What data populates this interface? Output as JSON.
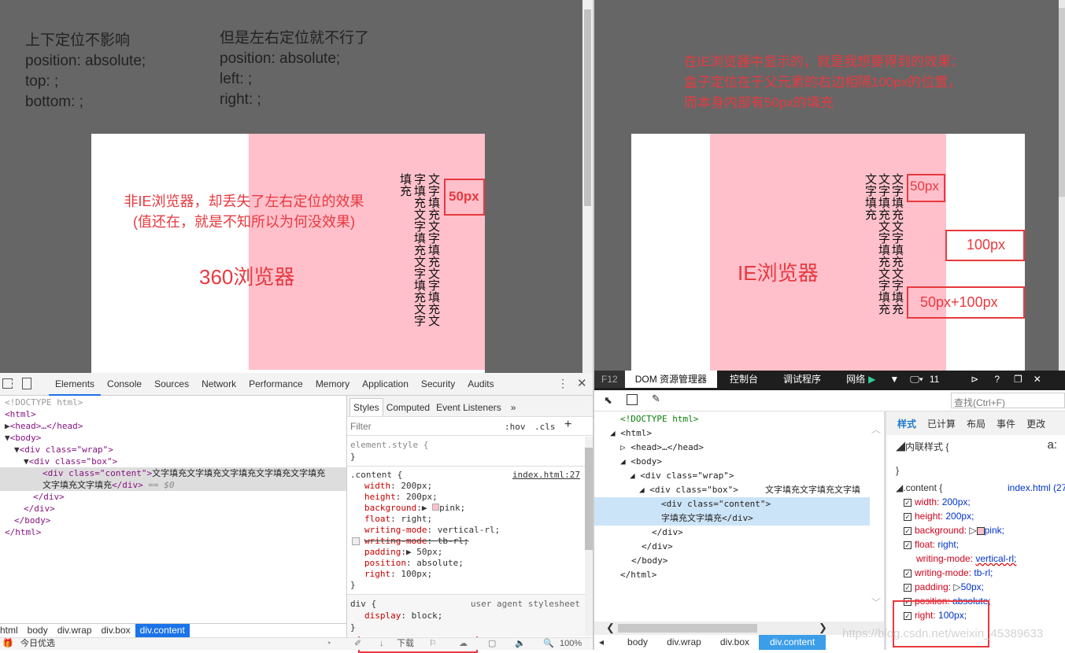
{
  "left_page": {
    "note1": [
      "上下定位不影响",
      "position: absolute;",
      "top: ;",
      "bottom: ;"
    ],
    "note2": [
      "但是左右定位就不行了",
      "position: absolute;",
      "left: ;",
      "right: ;"
    ],
    "annotation": [
      "非IE浏览器，却丢失了左右定位的效果",
      "(值还在，就是不知所以为何没效果)"
    ],
    "browser_label": "360浏览器",
    "padding_label": "50px",
    "content_text": "文字填充文字填充文字填充文字填充文字填充文字填充文字填充"
  },
  "right_page": {
    "annotation": [
      "在IE浏览器中显示的，就是我想要得到的效果：",
      "盒子定位在于父元素的右边相隔100px的位置，",
      "而本身内部有50px的填充"
    ],
    "browser_label": "IE浏览器",
    "padding_label": "50px",
    "right_label": "100px",
    "sum_label": "50px+100px",
    "content_text": "文字填充文字填充文字填充文字填充文字填充文字填充文字填充"
  },
  "chrome_devtools": {
    "tabs": [
      "Elements",
      "Console",
      "Sources",
      "Network",
      "Performance",
      "Memory",
      "Application",
      "Security",
      "Audits"
    ],
    "active_tab": "Elements",
    "dom": {
      "doctype": "<!DOCTYPE html>",
      "html": "<html>",
      "head": "<head>…</head>",
      "body": "<body>",
      "wrap": "<div class=\"wrap\">",
      "box": "<div class=\"box\">",
      "content_open": "<div class=\"content\">",
      "content_text1": "文字填充文字填充文字填充文字填充文字填充",
      "content_text2": "文字填充文字填充",
      "content_close": "</div>",
      "selected_marker": "== $0",
      "close_div": "</div>",
      "close_body": "</body>",
      "close_html": "</html>"
    },
    "breadcrumb": [
      "html",
      "body",
      "div.wrap",
      "div.box",
      "div.content"
    ],
    "styles_tabs": [
      "Styles",
      "Computed",
      "Event Listeners",
      "»"
    ],
    "filter_placeholder": "Filter",
    "hov": ":hov",
    "cls": ".cls",
    "plus": "+",
    "element_style": "element.style {",
    "close_brace": "}",
    "rule_selector": ".content {",
    "rule_source": "index.html:27",
    "props": [
      [
        "width",
        "200px;"
      ],
      [
        "height",
        "200px;"
      ],
      [
        "background",
        "pink;"
      ],
      [
        "float",
        "right;"
      ],
      [
        "writing-mode",
        "vertical-rl;"
      ],
      [
        "writing-mode",
        "tb-rl;"
      ],
      [
        "padding",
        "50px;"
      ],
      [
        "position",
        "absolute;"
      ],
      [
        "right",
        "100px;"
      ]
    ],
    "ua_selector": "div {",
    "ua_source": "user agent stylesheet",
    "ua_prop": [
      "display",
      "block;"
    ],
    "status": {
      "promo": "今日优选",
      "download": "下载",
      "zoom": "100%"
    }
  },
  "ie_devtools": {
    "f12": "F12",
    "tabs": [
      "DOM 资源管理器",
      "控制台",
      "调试程序",
      "网络"
    ],
    "version": "11",
    "search_placeholder": "查找(Ctrl+F)",
    "dom": {
      "doctype": "<!DOCTYPE html>",
      "html": "<html>",
      "head": "<head>…</head>",
      "body": "<body>",
      "wrap": "<div class=\"wrap\">",
      "box": "<div class=\"box\">",
      "content_open": "<div class=\"content\">",
      "content_text1": "文字填充文字填充文字填",
      "content_text2": "字填充文字填充</div>",
      "close_div": "</div>",
      "close_body": "</body>",
      "close_html": "</html>"
    },
    "style_tabs": [
      "样式",
      "已计算",
      "布局",
      "事件",
      "更改"
    ],
    "inline_style": "内联样式 {",
    "font_icon": "a:",
    "close_brace": "}",
    "rule_selector": ".content {",
    "rule_source": "index.html (27",
    "props": [
      [
        "width:",
        "200px;"
      ],
      [
        "height:",
        "200px;"
      ],
      [
        "background:",
        "pink;"
      ],
      [
        "float:",
        "right;"
      ],
      [
        "writing-mode:",
        "vertical-rl;"
      ],
      [
        "writing-mode:",
        "tb-rl;"
      ],
      [
        "padding:",
        "50px;"
      ],
      [
        "position:",
        "absolute;"
      ],
      [
        "right:",
        "100px;"
      ]
    ],
    "breadcrumb": [
      "body",
      "div.wrap",
      "div.box",
      "div.content"
    ],
    "watermark": "https://blog.csdn.net/weixin_45389633"
  },
  "colors": {
    "pink": "#ffc0cb",
    "annotation_red": "#e8393f",
    "page_bg": "#666666",
    "selection_blue": "#1a73e8"
  }
}
